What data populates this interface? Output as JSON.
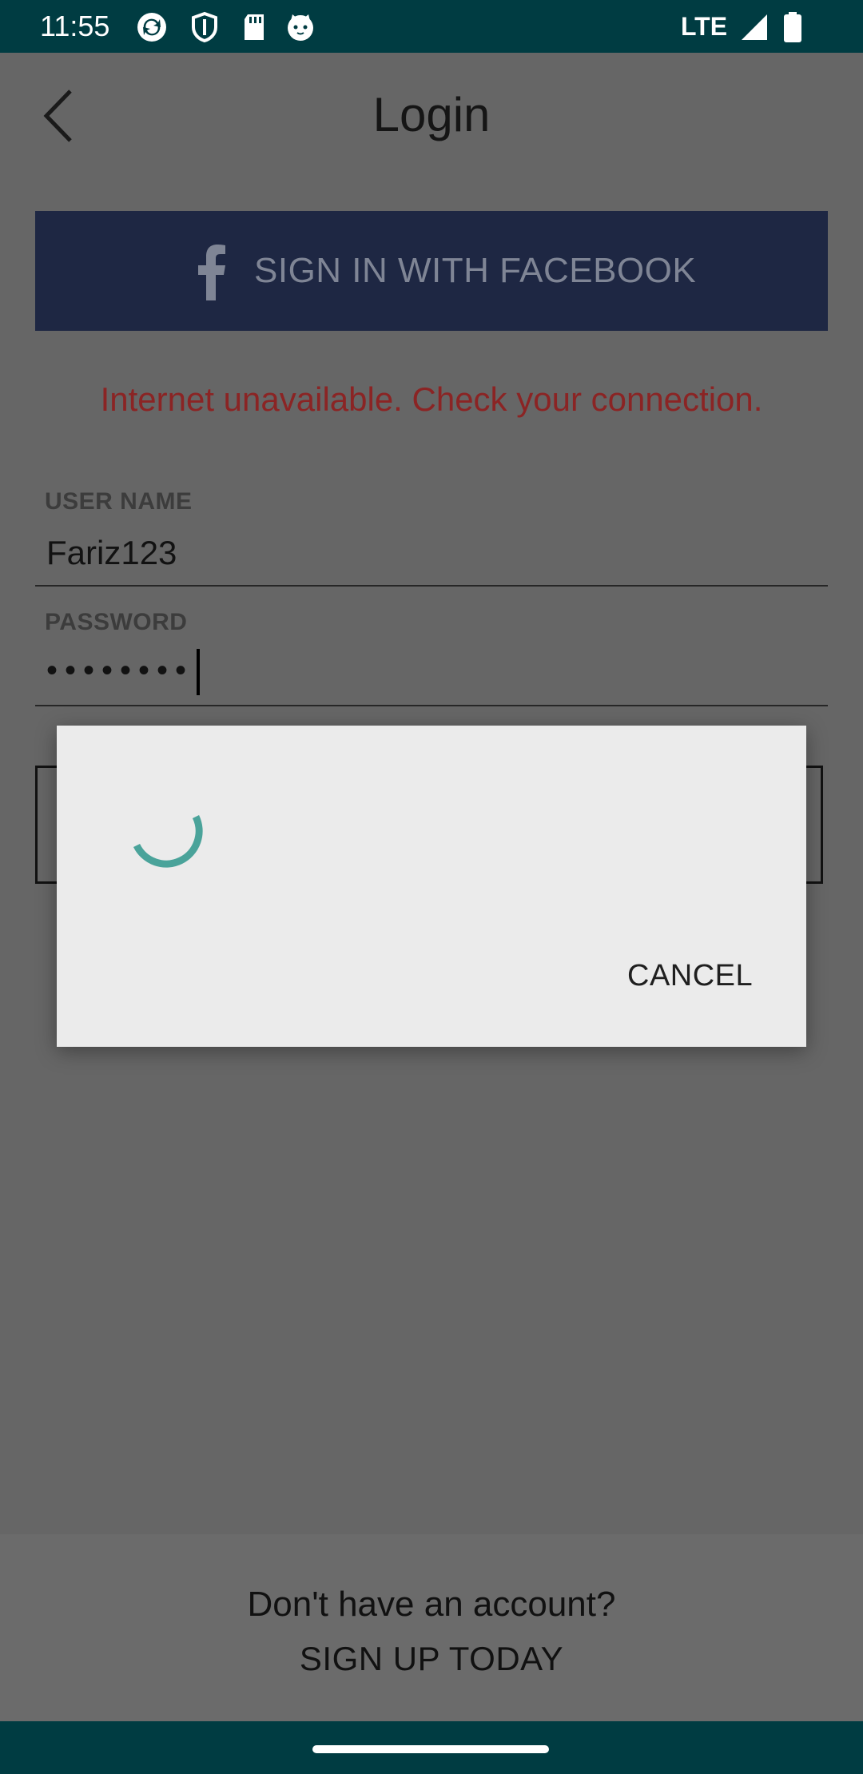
{
  "status_bar": {
    "time": "11:55",
    "network": "LTE",
    "icons": [
      "sync-icon",
      "shield-icon",
      "sd-card-icon",
      "cat-icon",
      "signal-icon",
      "battery-icon"
    ]
  },
  "header": {
    "title": "Login",
    "back_icon": "chevron-left-icon"
  },
  "facebook": {
    "label": "SIGN IN WITH FACEBOOK",
    "icon": "facebook-icon"
  },
  "error_message": "Internet unavailable. Check your connection.",
  "form": {
    "username_label": "USER NAME",
    "username_value": "Fariz123",
    "password_label": "PASSWORD",
    "password_value": "••••••••"
  },
  "dialog": {
    "cancel_label": "CANCEL"
  },
  "footer": {
    "question": "Don't have an account?",
    "signup_label": "SIGN UP TODAY"
  },
  "colors": {
    "status_bar": "#003c42",
    "scrim_background": "#666666",
    "facebook_button": "#1e2743",
    "error_text": "#8b2424",
    "dialog_background": "#ebebeb",
    "spinner": "#4aa39a"
  }
}
